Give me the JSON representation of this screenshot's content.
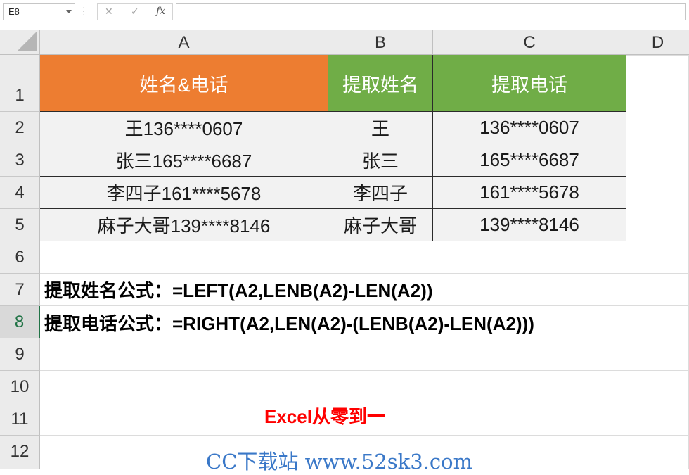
{
  "formula_bar": {
    "name_box": "E8",
    "cancel_icon": "✕",
    "confirm_icon": "✓",
    "fx_icon": "fx",
    "formula_value": ""
  },
  "columns": [
    "A",
    "B",
    "C",
    "D"
  ],
  "rows": [
    "1",
    "2",
    "3",
    "4",
    "5",
    "6",
    "7",
    "8",
    "9",
    "10",
    "11",
    "12"
  ],
  "selected_row": "8",
  "table": {
    "headers": [
      "姓名&电话",
      "提取姓名",
      "提取电话"
    ],
    "header_colors": [
      "#ED7D31",
      "#70AD47",
      "#70AD47"
    ],
    "rows": [
      [
        "王136****0607",
        "王",
        "136****0607"
      ],
      [
        "张三165****6687",
        "张三",
        "165****6687"
      ],
      [
        "李四子161****5678",
        "李四子",
        "161****5678"
      ],
      [
        "麻子大哥139****8146",
        "麻子大哥",
        "139****8146"
      ]
    ]
  },
  "formulas": {
    "name_formula": "提取姓名公式：=LEFT(A2,LENB(A2)-LEN(A2))",
    "phone_formula": "提取电话公式：=RIGHT(A2,LEN(A2)-(LENB(A2)-LEN(A2)))"
  },
  "brand_text": "Excel从零到一",
  "watermark": "CC下载站 www.52sk3.com",
  "colors": {
    "brand": "#FF0000",
    "watermark": "#3A78C8",
    "selection": "#217346"
  }
}
